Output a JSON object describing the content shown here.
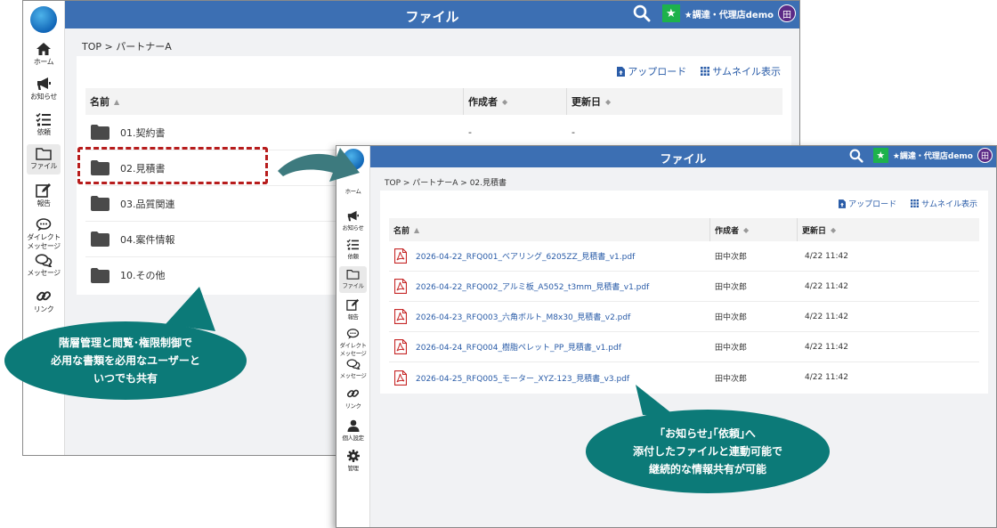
{
  "window_back": {
    "header_title": "ファイル",
    "user_name": "★調達・代理店demo",
    "avatar_text": "田",
    "breadcrumb": "TOP > パートナーA",
    "toolbar": {
      "upload_label": "アップロード",
      "thumbnail_label": "サムネイル表示"
    },
    "columns": {
      "name": "名前",
      "author": "作成者",
      "updated": "更新日"
    },
    "folders": [
      {
        "name": "01.契約書",
        "author": "-",
        "updated": "-"
      },
      {
        "name": "02.見積書",
        "author": "",
        "updated": ""
      },
      {
        "name": "03.品質関連",
        "author": "",
        "updated": ""
      },
      {
        "name": "04.案件情報",
        "author": "",
        "updated": ""
      },
      {
        "name": "10.その他",
        "author": "",
        "updated": ""
      }
    ],
    "sidebar": [
      {
        "label": "ホーム",
        "icon": "home-icon"
      },
      {
        "label": "お知らせ",
        "icon": "megaphone-icon"
      },
      {
        "label": "依頼",
        "icon": "tasks-icon"
      },
      {
        "label": "ファイル",
        "icon": "folder-icon"
      },
      {
        "label": "報告",
        "icon": "edit-icon"
      },
      {
        "label": "ダイレクト",
        "label2": "メッセージ",
        "icon": "direct-message-icon"
      },
      {
        "label": "メッセージ",
        "icon": "messages-icon"
      },
      {
        "label": "リンク",
        "icon": "link-icon"
      }
    ]
  },
  "window_front": {
    "header_title": "ファイル",
    "user_name": "★調達・代理店demo",
    "avatar_text": "田",
    "breadcrumb": "TOP > パートナーA > 02.見積書",
    "toolbar": {
      "upload_label": "アップロード",
      "thumbnail_label": "サムネイル表示"
    },
    "columns": {
      "name": "名前",
      "author": "作成者",
      "updated": "更新日"
    },
    "files": [
      {
        "name": "2026-04-22_RFQ001_ベアリング_6205ZZ_見積書_v1.pdf",
        "author": "田中次郎",
        "updated": "4/22 11:42"
      },
      {
        "name": "2026-04-22_RFQ002_アルミ板_A5052_t3mm_見積書_v1.pdf",
        "author": "田中次郎",
        "updated": "4/22 11:42"
      },
      {
        "name": "2026-04-23_RFQ003_六角ボルト_M8x30_見積書_v2.pdf",
        "author": "田中次郎",
        "updated": "4/22 11:42"
      },
      {
        "name": "2026-04-24_RFQ004_樹脂ペレット_PP_見積書_v1.pdf",
        "author": "田中次郎",
        "updated": "4/22 11:42"
      },
      {
        "name": "2026-04-25_RFQ005_モーター_XYZ-123_見積書_v3.pdf",
        "author": "田中次郎",
        "updated": "4/22 11:42"
      }
    ],
    "sidebar": [
      {
        "label": "ホーム",
        "icon": "home-icon"
      },
      {
        "label": "お知らせ",
        "icon": "megaphone-icon"
      },
      {
        "label": "依頼",
        "icon": "tasks-icon"
      },
      {
        "label": "ファイル",
        "icon": "folder-icon"
      },
      {
        "label": "報告",
        "icon": "edit-icon"
      },
      {
        "label": "ダイレクト",
        "label2": "メッセージ",
        "icon": "direct-message-icon"
      },
      {
        "label": "メッセージ",
        "icon": "messages-icon"
      },
      {
        "label": "リンク",
        "icon": "link-icon"
      },
      {
        "label": "個人設定",
        "icon": "person-icon"
      },
      {
        "label": "管理",
        "icon": "settings-icon"
      }
    ]
  },
  "callouts": {
    "left": [
      "階層管理と閲覧･権限制御で",
      "必用な書類を必用なユーザーと",
      "いつでも共有"
    ],
    "right": [
      "｢お知らせ｣｢依頼｣へ",
      "添付したファイルと連動可能で",
      "継続的な情報共有が可能"
    ]
  },
  "colors": {
    "header": "#3c6fb3",
    "callout": "#0c7a78",
    "highlight_dashed": "#b71c1c",
    "link": "#2a5ca8",
    "pdf_red": "#c62828"
  }
}
